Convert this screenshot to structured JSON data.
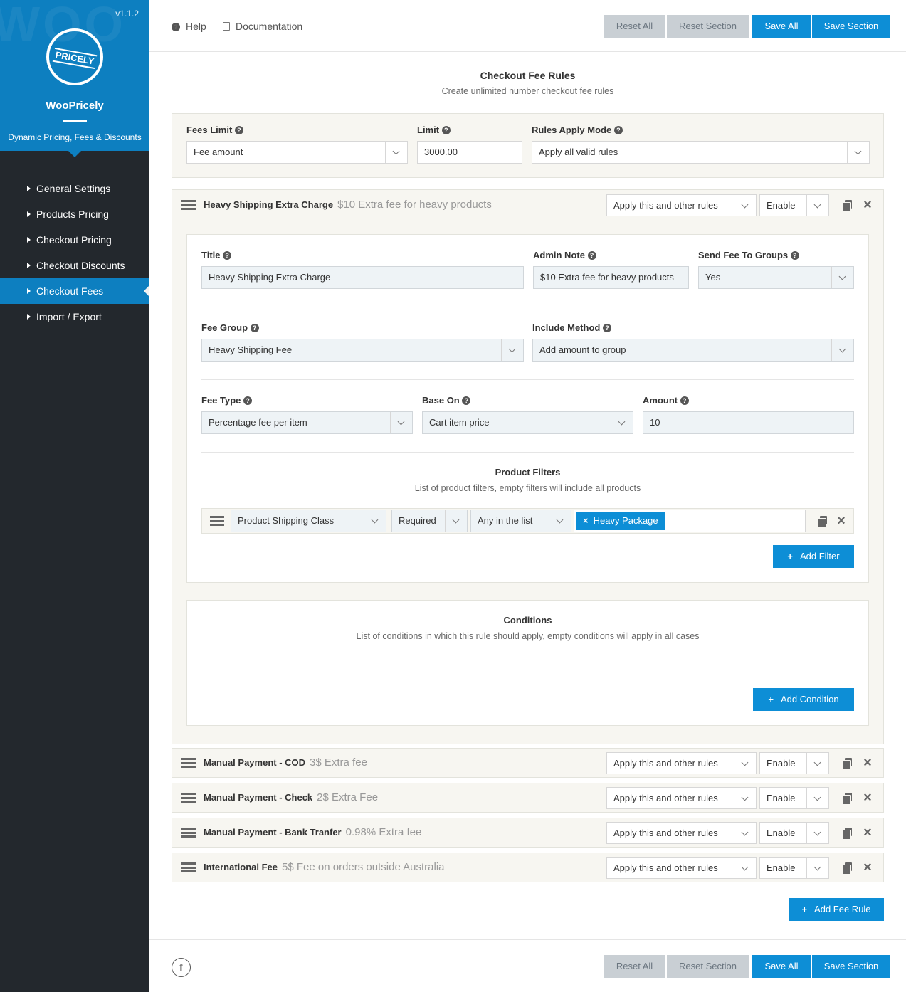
{
  "brand": {
    "version": "v1.1.2",
    "logo_text": "PRICELY",
    "name": "WooPricely",
    "tagline": "Dynamic Pricing, Fees & Discounts",
    "watermark": "WOO"
  },
  "sidebar": {
    "items": [
      {
        "label": "General Settings"
      },
      {
        "label": "Products Pricing"
      },
      {
        "label": "Checkout Pricing"
      },
      {
        "label": "Checkout Discounts"
      },
      {
        "label": "Checkout Fees",
        "active": true
      },
      {
        "label": "Import / Export"
      }
    ]
  },
  "toolbar": {
    "help": "Help",
    "documentation": "Documentation",
    "reset_all": "Reset All",
    "reset_section": "Reset Section",
    "save_all": "Save All",
    "save_section": "Save Section"
  },
  "page": {
    "title": "Checkout Fee Rules",
    "subtitle": "Create unlimited number checkout fee rules"
  },
  "global": {
    "fees_limit": {
      "label": "Fees Limit",
      "value": "Fee amount"
    },
    "limit": {
      "label": "Limit",
      "value": "3000.00"
    },
    "apply_mode": {
      "label": "Rules Apply Mode",
      "value": "Apply all valid rules"
    }
  },
  "rules": [
    {
      "title": "Heavy Shipping Extra Charge",
      "note": "$10 Extra fee for heavy products",
      "apply": "Apply this and other rules",
      "status": "Enable"
    },
    {
      "title": "Manual Payment - COD",
      "note": "3$ Extra fee",
      "apply": "Apply this and other rules",
      "status": "Enable"
    },
    {
      "title": "Manual Payment - Check",
      "note": "2$ Extra Fee",
      "apply": "Apply this and other rules",
      "status": "Enable"
    },
    {
      "title": "Manual Payment - Bank Tranfer",
      "note": "0.98% Extra fee",
      "apply": "Apply this and other rules",
      "status": "Enable"
    },
    {
      "title": "International Fee",
      "note": "5$ Fee on orders outside Australia",
      "apply": "Apply this and other rules",
      "status": "Enable"
    }
  ],
  "editor": {
    "title": {
      "label": "Title",
      "value": "Heavy Shipping Extra Charge"
    },
    "admin_note": {
      "label": "Admin Note",
      "value": "$10 Extra fee for heavy products"
    },
    "send_groups": {
      "label": "Send Fee To Groups",
      "value": "Yes"
    },
    "fee_group": {
      "label": "Fee Group",
      "value": "Heavy Shipping Fee"
    },
    "include_method": {
      "label": "Include Method",
      "value": "Add amount to group"
    },
    "fee_type": {
      "label": "Fee Type",
      "value": "Percentage fee per item"
    },
    "base_on": {
      "label": "Base On",
      "value": "Cart item price"
    },
    "amount": {
      "label": "Amount",
      "value": "10"
    }
  },
  "filters": {
    "title": "Product Filters",
    "subtitle": "List of product filters, empty filters will include all products",
    "row": {
      "type": "Product Shipping Class",
      "required": "Required",
      "match": "Any in the list",
      "tag": "Heavy Package"
    },
    "add_label": "Add Filter"
  },
  "conditions": {
    "title": "Conditions",
    "subtitle": "List of conditions in which this rule should apply, empty conditions will apply in all cases",
    "add_label": "Add Condition"
  },
  "add_rule_label": "Add Fee Rule",
  "footer": {
    "facebook": "f",
    "reset_all": "Reset All",
    "reset_section": "Reset Section",
    "save_all": "Save All",
    "save_section": "Save Section"
  },
  "colors": {
    "accent": "#0d8ed6",
    "sidebar": "#23282d",
    "brand": "#0d7fc0"
  },
  "icons": {
    "help": "question-circle-icon",
    "docs": "document-icon",
    "drag": "hamburger-icon",
    "copy": "copy-icon",
    "delete": "close-icon",
    "facebook": "facebook-icon"
  }
}
